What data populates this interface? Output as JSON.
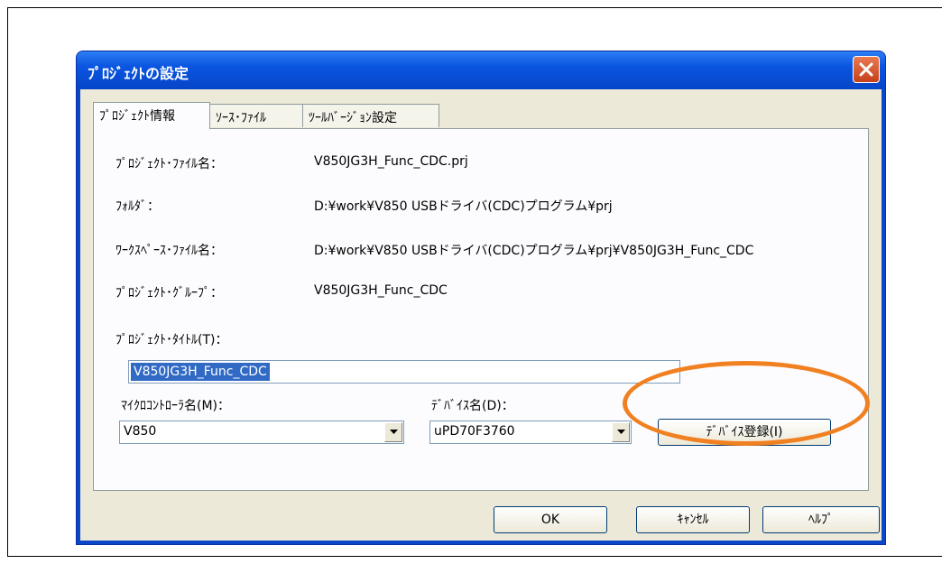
{
  "dialog": {
    "title": "ﾌﾟﾛｼﾞｪｸﾄの設定"
  },
  "tabs": [
    {
      "label": "ﾌﾟﾛｼﾞｪｸﾄ情報"
    },
    {
      "label": "ｿｰｽ･ﾌｧｲﾙ"
    },
    {
      "label": "ﾂｰﾙﾊﾞｰｼﾞｮﾝ設定"
    }
  ],
  "info": {
    "project_file_label": "ﾌﾟﾛｼﾞｪｸﾄ･ﾌｧｲﾙ名：",
    "project_file_value": "V850JG3H_Func_CDC.prj",
    "folder_label": "ﾌｫﾙﾀﾞ：",
    "folder_value": "D:¥work¥V850 USBドライバ(CDC)プログラム¥prj",
    "workspace_label": "ﾜｰｸｽﾍﾟｰｽ･ﾌｧｲﾙ名：",
    "workspace_value": "D:¥work¥V850 USBドライバ(CDC)プログラム¥prj¥V850JG3H_Func_CDC",
    "group_label": "ﾌﾟﾛｼﾞｪｸﾄ･ｸﾞﾙｰﾌﾟ：",
    "group_value": "V850JG3H_Func_CDC",
    "title_label": "ﾌﾟﾛｼﾞｪｸﾄ･ﾀｲﾄﾙ(T)：",
    "title_value": "V850JG3H_Func_CDC"
  },
  "micro": {
    "label": "ﾏｲｸﾛｺﾝﾄﾛｰﾗ名(M)：",
    "value": "V850"
  },
  "device": {
    "label": "ﾃﾞﾊﾞｲｽ名(D)：",
    "value": "uPD70F3760",
    "register_button": "ﾃﾞﾊﾞｲｽ登録(I)"
  },
  "footer": {
    "ok": "OK",
    "cancel": "ｷｬﾝｾﾙ",
    "help": "ﾍﾙﾌﾟ"
  },
  "colors": {
    "titlebar": "#0a55e0",
    "client": "#ece9d8",
    "highlight": "#f08020"
  }
}
